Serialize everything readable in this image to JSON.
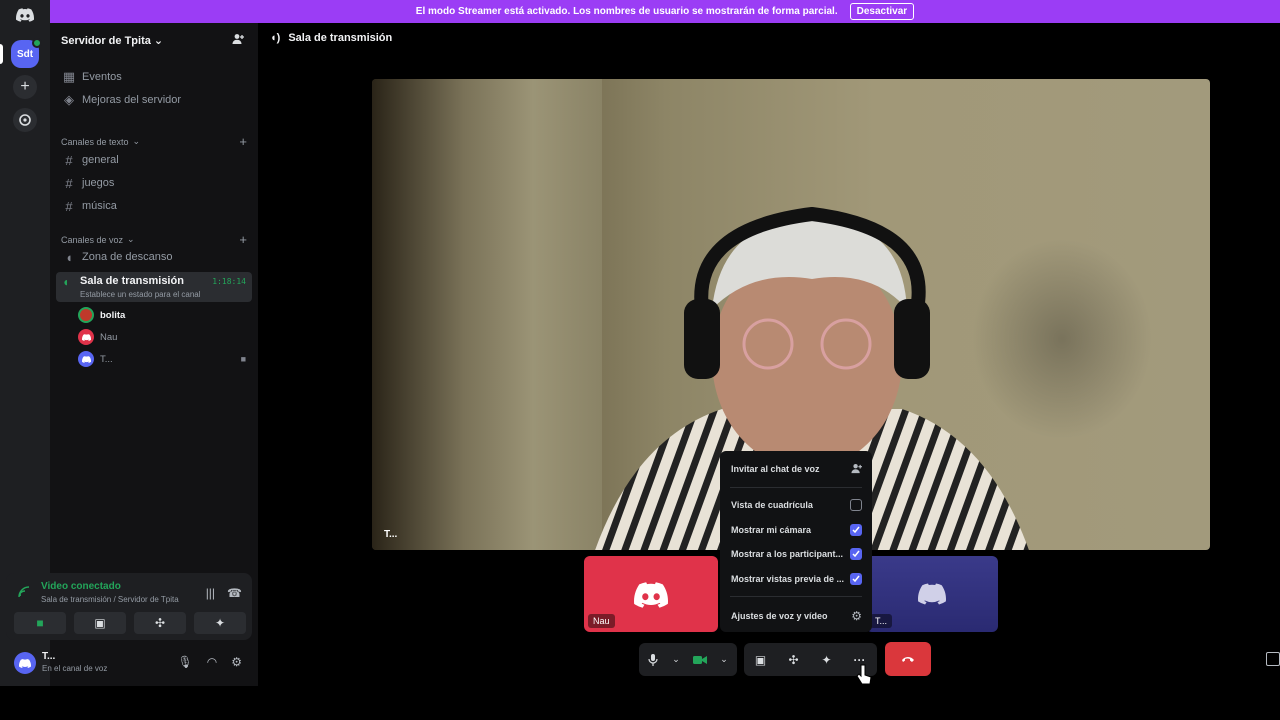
{
  "banner": {
    "text": "El modo Streamer está activado. Los nombres de usuario se mostrarán de forma parcial.",
    "button": "Desactivar"
  },
  "rail": {
    "server_initials": "Sdt"
  },
  "sidebar": {
    "server_name": "Servidor de Tpita",
    "top_items": [
      {
        "label": "Eventos",
        "icon": "calendar-icon"
      },
      {
        "label": "Mejoras del servidor",
        "icon": "boost-icon"
      }
    ],
    "text_category": "Canales de texto",
    "text_channels": [
      "general",
      "juegos",
      "música"
    ],
    "voice_category": "Canales de voz",
    "voice_channels": [
      {
        "label": "Zona de descanso"
      }
    ],
    "active_channel": {
      "label": "Sala de transmisión",
      "timer": "1:18:14",
      "status": "Establece un estado para el canal"
    },
    "voice_users": [
      {
        "name": "bolita",
        "color": "#c0392b"
      },
      {
        "name": "Nau",
        "color": "#e0334a"
      },
      {
        "name": "T...",
        "color": "#5865f2"
      }
    ]
  },
  "voice_panel": {
    "title": "Video conectado",
    "subtitle": "Sala de transmisión / Servidor de Tpita"
  },
  "user_bar": {
    "name": "T...",
    "status": "En el canal de voz"
  },
  "main": {
    "title": "Sala de transmisión",
    "video_label": "T...",
    "tiles": [
      {
        "label": "Nau",
        "color": "#e0334a"
      },
      {
        "label": "T...",
        "color": "#2a2a72"
      }
    ]
  },
  "menu": {
    "invite": "Invitar al chat de voz",
    "items": [
      {
        "label": "Vista de cuadrícula",
        "checked": false
      },
      {
        "label": "Mostrar mi cámara",
        "checked": true
      },
      {
        "label": "Mostrar a los participant...",
        "checked": true
      },
      {
        "label": "Mostrar vistas previa de ...",
        "checked": true
      }
    ],
    "settings": "Ajustes de voz y vídeo"
  }
}
